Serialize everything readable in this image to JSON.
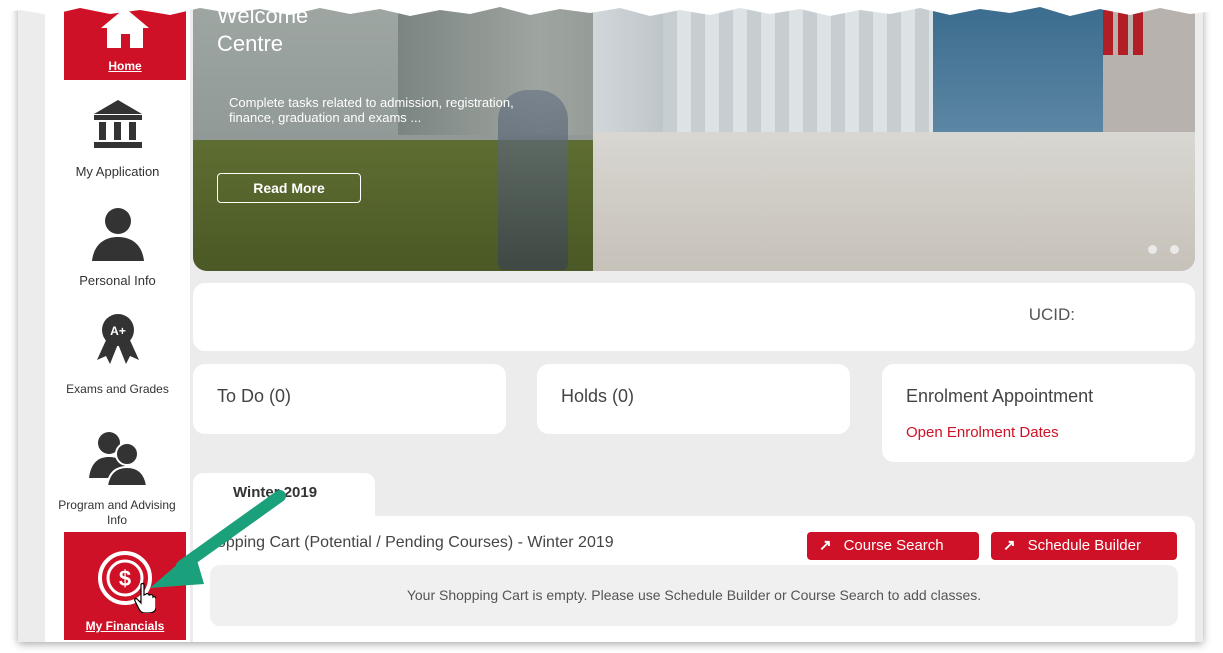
{
  "sidebar": {
    "items": [
      {
        "label": "Home",
        "icon": "home-icon"
      },
      {
        "label": "My Application",
        "icon": "institution-icon"
      },
      {
        "label": "Personal Info",
        "icon": "person-icon"
      },
      {
        "label": "Exams and Grades",
        "icon": "award-ribbon-icon"
      },
      {
        "label": "Program and Advising Info",
        "icon": "people-icon"
      },
      {
        "label": "My Financials",
        "icon": "dollar-icon"
      }
    ],
    "ribbon_text": "A+"
  },
  "banner": {
    "title_partial": "Welcome",
    "title_line2": "Centre",
    "text": "Complete tasks related to admission, registration, finance, graduation and exams ...",
    "read_more": "Read More"
  },
  "student": {
    "ucid_label": "UCID:"
  },
  "cards": {
    "todo": "To Do (0)",
    "holds": "Holds (0)",
    "enrolment_title": "Enrolment Appointment",
    "enrolment_link": "Open Enrolment Dates"
  },
  "term_tab": "Winter 2019",
  "cart": {
    "title": "opping Cart (Potential / Pending Courses) - Winter 2019",
    "course_search": "Course Search",
    "schedule_builder": "Schedule Builder",
    "empty_message": "Your Shopping Cart is empty. Please use Schedule Builder or Course Search to add classes."
  },
  "colors": {
    "brand_red": "#ce1126",
    "arrow_green": "#1aa07a",
    "background": "#ececec"
  }
}
